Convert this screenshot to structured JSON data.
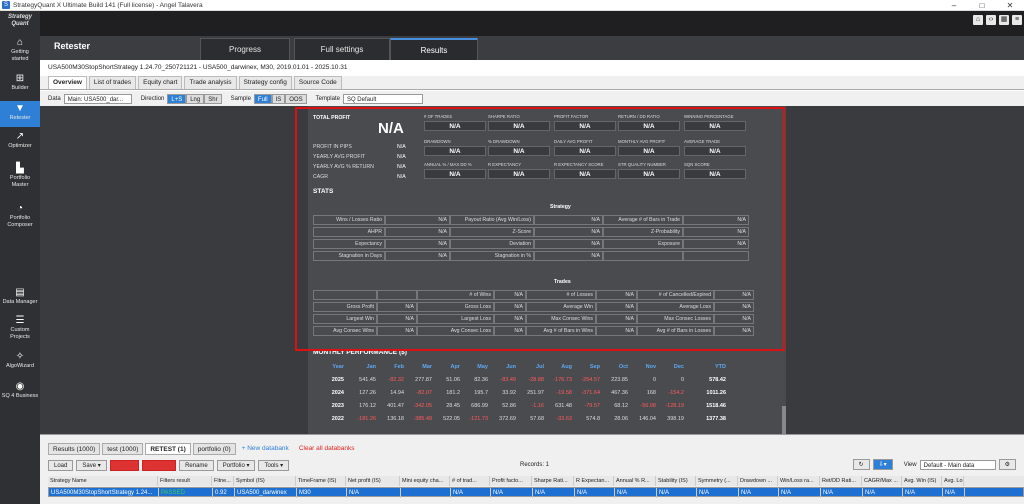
{
  "window": {
    "title": "StrategyQuant X Ultimate Build 141 (Full license) - Angel Talavera",
    "app_icon": "sq-app-icon",
    "controls": [
      "–",
      "□",
      "✕"
    ]
  },
  "sidebar": {
    "logo_line1": "Strategy",
    "logo_line2": "Quant",
    "items": [
      {
        "label1": "Getting",
        "label2": "started",
        "icon": "home-icon"
      },
      {
        "label1": "Builder",
        "label2": "",
        "icon": "plus-icon"
      },
      {
        "label1": "Retester",
        "label2": "",
        "icon": "filter-icon"
      },
      {
        "label1": "Optimizer",
        "label2": "",
        "icon": "trend-icon"
      },
      {
        "label1": "Portfolio",
        "label2": "Master",
        "icon": "bar-chart-icon"
      },
      {
        "label1": "Portfolio",
        "label2": "Composer",
        "icon": "pie-chart-icon"
      },
      {
        "label1": "Data Manager",
        "label2": "",
        "icon": "database-icon"
      },
      {
        "label1": "Custom",
        "label2": "Projects",
        "icon": "list-icon"
      },
      {
        "label1": "AlgoWizard",
        "label2": "",
        "icon": "wand-icon"
      },
      {
        "label1": "SQ 4 Business",
        "label2": "",
        "icon": "globe-icon"
      }
    ]
  },
  "header": {
    "title": "Retester",
    "tabs": [
      "Progress",
      "Full settings",
      "Results"
    ],
    "active_tab": "Results"
  },
  "strategy_info": "USA500M30StopShortStrategy 1.24.70_250721121 - USA500_darwinex, M30, 2019.01.01 - 2025.10.31",
  "subtabs": [
    "Overview",
    "List of trades",
    "Equity chart",
    "Trade analysis",
    "Strategy config",
    "Source Code"
  ],
  "filters": {
    "data_label": "Data",
    "data_value": "Main: USA500_dar...",
    "direction_label": "Direction",
    "directions": [
      "L+S",
      "Lng",
      "Shr"
    ],
    "sample_label": "Sample",
    "samples": [
      "Full",
      "IS",
      "OOS"
    ],
    "template_label": "Template",
    "template_value": "SQ Default"
  },
  "overview": {
    "total_profit_label": "TOTAL PROFIT",
    "total_profit_value": "N/A",
    "left_metrics": [
      {
        "label": "PROFIT IN PIPS",
        "value": "N/A"
      },
      {
        "label": "YEARLY AVG PROFIT",
        "value": "N/A"
      },
      {
        "label": "YEARLY AVG % RETURN",
        "value": "N/A"
      },
      {
        "label": "CAGR",
        "value": "N/A"
      }
    ],
    "boxes": [
      {
        "label": "# OF TRADES",
        "value": "N/A"
      },
      {
        "label": "SHARPE RATIO",
        "value": "N/A"
      },
      {
        "label": "PROFIT FACTOR",
        "value": "N/A"
      },
      {
        "label": "RETURN / DD RATIO",
        "value": "N/A"
      },
      {
        "label": "WINNING PERCENTAGE",
        "value": "N/A"
      },
      {
        "label": "DRAWDOWN",
        "value": "N/A"
      },
      {
        "label": "% DRAWDOWN",
        "value": "N/A"
      },
      {
        "label": "DAILY AVG PROFIT",
        "value": "N/A"
      },
      {
        "label": "MONTHLY AVG PROFIT",
        "value": "N/A"
      },
      {
        "label": "AVERAGE TRADE",
        "value": "N/A"
      },
      {
        "label": "ANNUAL % / MAX DD %",
        "value": "N/A"
      },
      {
        "label": "R EXPECTANCY",
        "value": "N/A"
      },
      {
        "label": "R EXPECTANCY SCORE",
        "value": "N/A"
      },
      {
        "label": "STR QUALITY NUMBER",
        "value": "N/A"
      },
      {
        "label": "SQN SCORE",
        "value": "N/A"
      }
    ],
    "stats_title": "STATS",
    "strategy_title": "Strategy",
    "strategy_rows": [
      [
        "Wins / Losses Ratio",
        "N/A",
        "Payout Ratio (Avg Win/Loss)",
        "N/A",
        "Average # of Bars in Trade",
        "N/A"
      ],
      [
        "AHPR",
        "N/A",
        "Z-Score",
        "N/A",
        "Z-Probability",
        "N/A"
      ],
      [
        "Expectancy",
        "N/A",
        "Deviation",
        "N/A",
        "Exposure",
        "N/A"
      ],
      [
        "Stagnation in Days",
        "N/A",
        "Stagnation in %",
        "N/A",
        "",
        ""
      ]
    ],
    "trades_title": "Trades",
    "trades_rows": [
      [
        "",
        "",
        "# of Wins",
        "N/A",
        "# of Losses",
        "N/A",
        "# of Cancelled/Expired",
        "N/A"
      ],
      [
        "Gross Profit",
        "N/A",
        "Gross Loss",
        "N/A",
        "Average Win",
        "N/A",
        "Average Loss",
        "N/A"
      ],
      [
        "Largest Win",
        "N/A",
        "Largest Loss",
        "N/A",
        "Max Consec Wins",
        "N/A",
        "Max Consec Losses",
        "N/A"
      ],
      [
        "Avg Consec Wins",
        "N/A",
        "Avg Consec Loss",
        "N/A",
        "Avg # of Bars in Wins",
        "N/A",
        "Avg # of Bars in Losses",
        "N/A"
      ]
    ],
    "monthly_title": "MONTHLY PERFORMANCE ($)",
    "monthly_headers": [
      "Year",
      "Jan",
      "Feb",
      "Mar",
      "Apr",
      "May",
      "Jun",
      "Jul",
      "Aug",
      "Sep",
      "Oct",
      "Nov",
      "Dec",
      "YTD"
    ],
    "monthly_rows": [
      [
        "2025",
        "541.45",
        "-82.32",
        "277.87",
        "51.06",
        "82.36",
        "-83.49",
        "-28.88",
        "-176.73",
        "-254.57",
        "223.85",
        "0",
        "0",
        "578.42"
      ],
      [
        "2024",
        "127.26",
        "14.94",
        "-82.07",
        "181.2",
        "195.7",
        "33.92",
        "251.97",
        "-19.58",
        "-371.64",
        "467.36",
        "168",
        "-154.2",
        "1011.26"
      ],
      [
        "2023",
        "176.12",
        "401.47",
        "-342.05",
        "28.45",
        "686.99",
        "52.86",
        "-1.16",
        "631.48",
        "-79.57",
        "68.12",
        "-56.08",
        "-128.19",
        "1518.46"
      ],
      [
        "2022",
        "-181.26",
        "136.18",
        "-385.48",
        "522.05",
        "-121.73",
        "372.69",
        "57.68",
        "-33.63",
        "574.8",
        "28.06",
        "146.04",
        "398.19",
        "1377.38"
      ]
    ]
  },
  "databank": {
    "tabs": [
      "Results (1000)",
      "test (1000)",
      "RETEST (1)",
      "portfolio (0)"
    ],
    "active_tab": "RETEST (1)",
    "new_label": "+ New databank",
    "clear_label": "Clear all databanks",
    "buttons": [
      "Load",
      "Save ▾",
      "Delete",
      "Clear all",
      "Rename",
      "Portfolio ▾",
      "Tools ▾"
    ],
    "records": "Records: 1",
    "view_label": "View",
    "view_value": "Default - Main data",
    "columns": [
      "Strategy Name",
      "Filters result",
      "Fitne...",
      "Symbol (IS)",
      "TimeFrame (IS)",
      "Net profit (IS)",
      "Mini equity cha...",
      "# of trad...",
      "Profit facto...",
      "Sharpe Rati...",
      "R Expectan...",
      "Annual % R...",
      "Stability (IS)",
      "Symmetry (...",
      "Drawdown ...",
      "Win/Loss ra...",
      "Ret/DD Rati...",
      "CAGR/Max ...",
      "Avg. Win (IS)",
      "Avg. Lo"
    ],
    "row": [
      "USA500M30StopShortStrategy 1.24...",
      "PASSED",
      "0.92",
      "USA500_darwinex",
      "M30",
      "N/A",
      "",
      "N/A",
      "N/A",
      "N/A",
      "N/A",
      "N/A",
      "N/A",
      "N/A",
      "N/A",
      "N/A",
      "N/A",
      "N/A",
      "N/A",
      "N/A"
    ]
  },
  "colors": {
    "accent": "#2e7fd6",
    "highlight_border": "#dd1111",
    "negative": "#ff5a5a",
    "passed": "#3ccf5a"
  }
}
